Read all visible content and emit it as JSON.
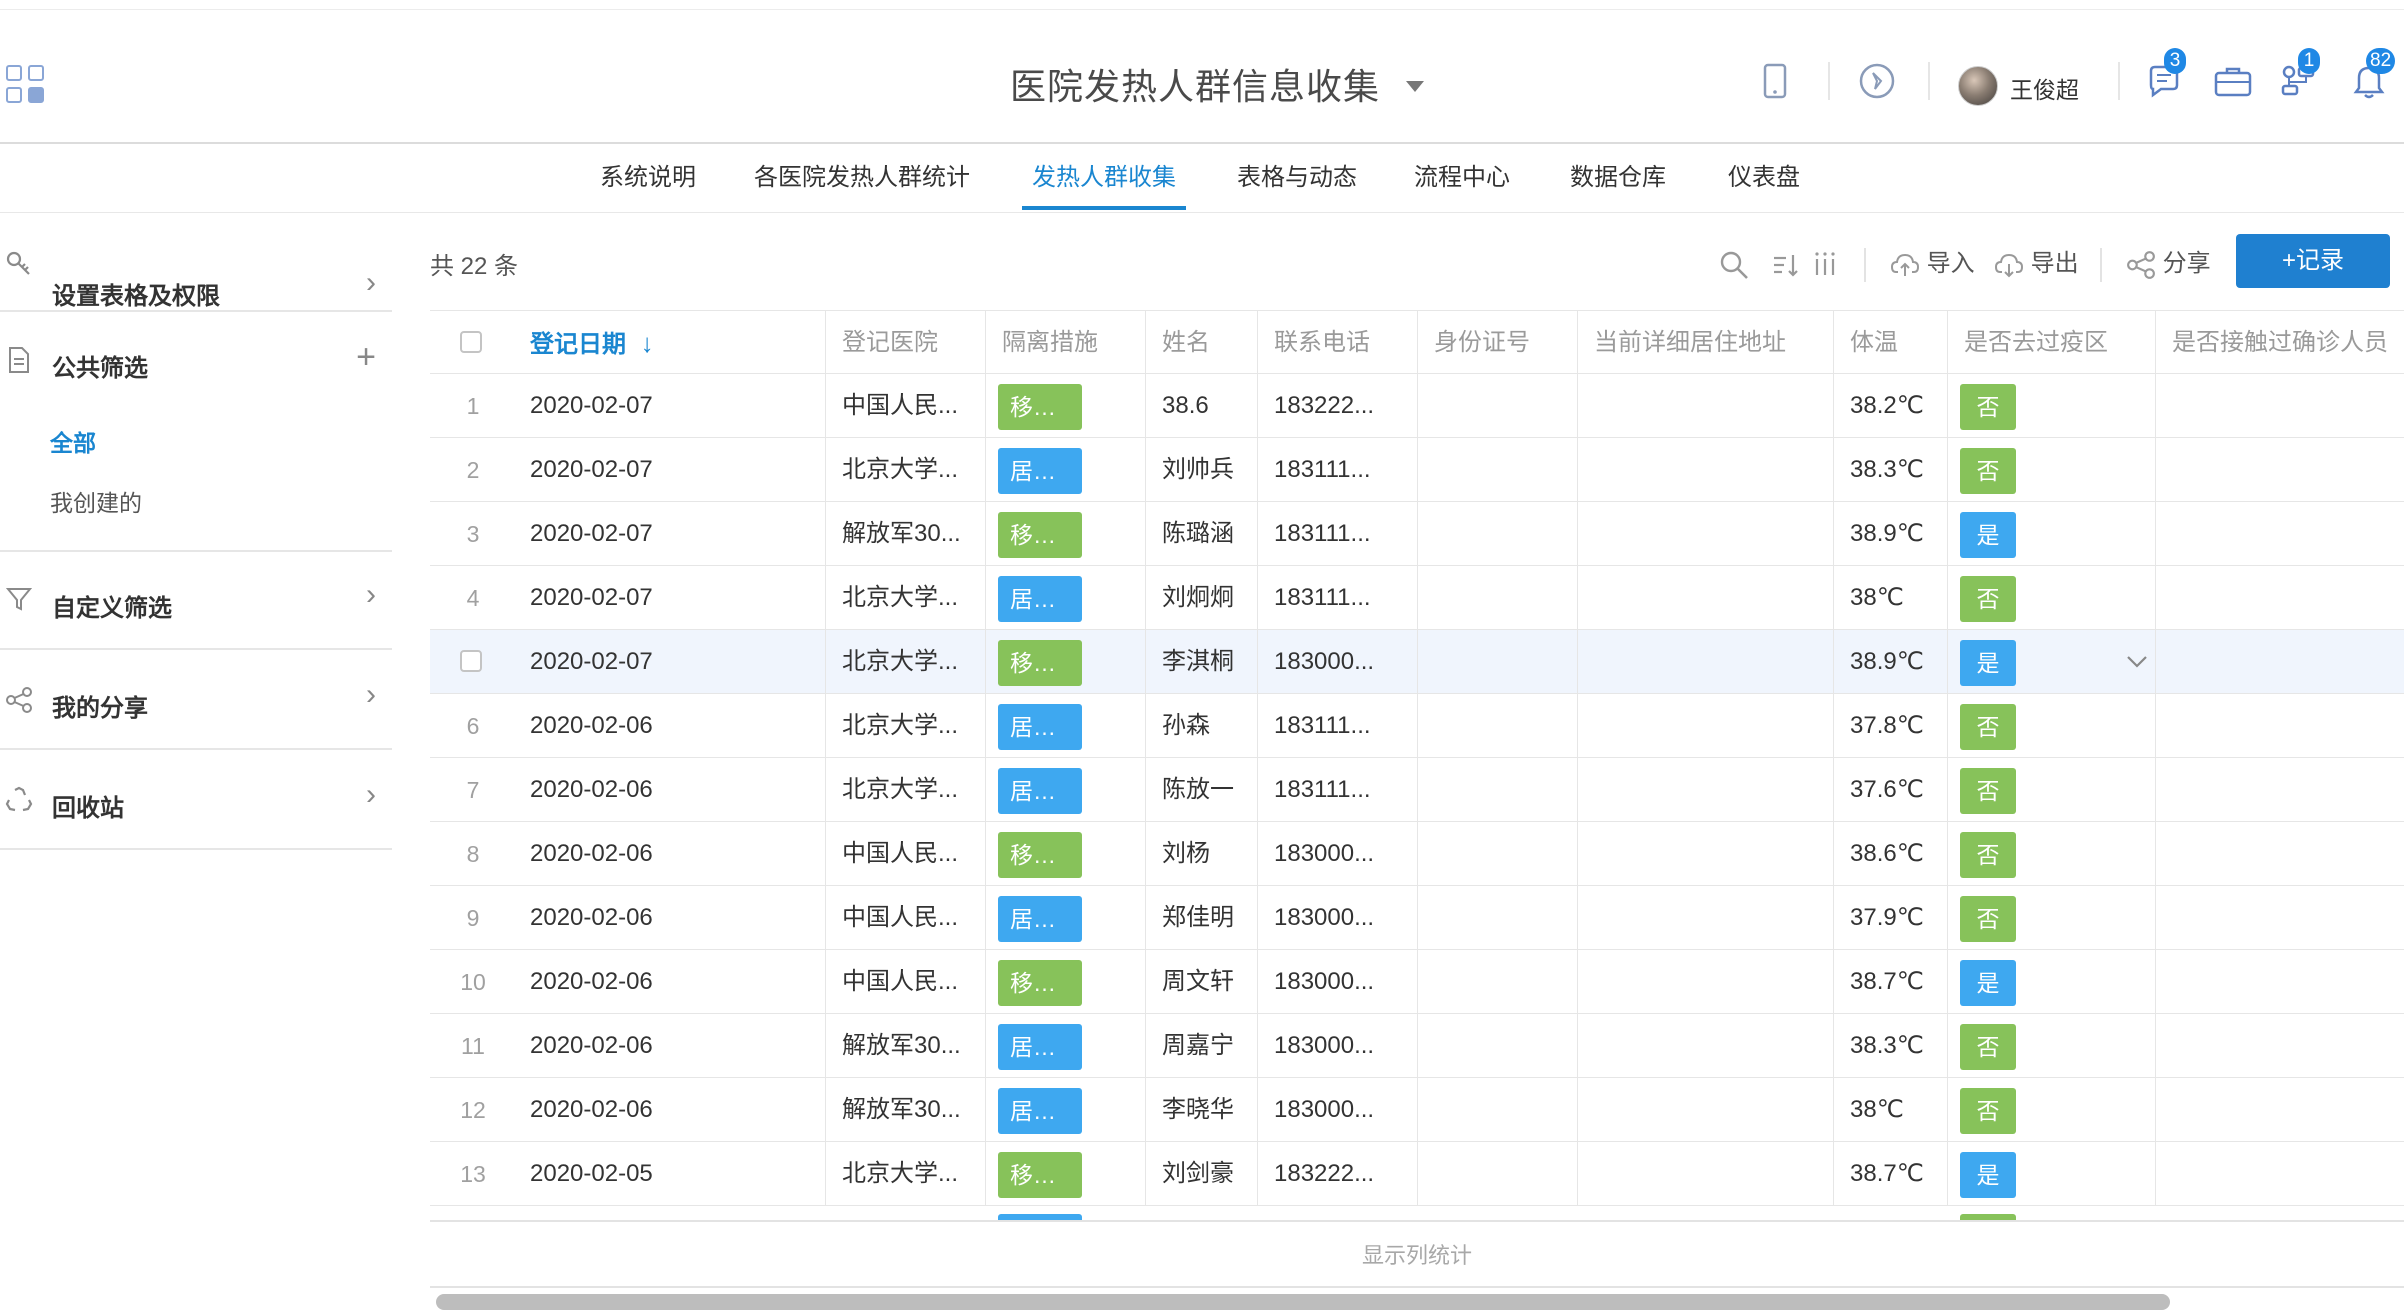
{
  "app": {
    "title": "医院发热人群信息收集",
    "username": "王俊超",
    "badges": {
      "messages": "3",
      "workflow": "1",
      "notifications": "82"
    }
  },
  "nav": {
    "tabs": [
      "系统说明",
      "各医院发热人群统计",
      "发热人群收集",
      "表格与动态",
      "流程中心",
      "数据仓库",
      "仪表盘"
    ],
    "active_tab": "发热人群收集"
  },
  "sidebar": {
    "settings_label": "设置表格及权限",
    "public_filter_label": "公共筛选",
    "filter_all": "全部",
    "filter_mine": "我创建的",
    "custom_filter_label": "自定义筛选",
    "my_share_label": "我的分享",
    "recycle_label": "回收站"
  },
  "toolbar": {
    "count_text": "共 22 条",
    "import_label": "导入",
    "export_label": "导出",
    "share_label": "分享",
    "add_record_label": "+记录"
  },
  "table": {
    "columns": [
      "登记日期",
      "登记医院",
      "隔离措施",
      "姓名",
      "联系电话",
      "身份证号",
      "当前详细居住地址",
      "体温",
      "是否去过疫区",
      "是否接触过确诊人员"
    ],
    "sorted_column": "登记日期",
    "rows": [
      {
        "num": "1",
        "date": "2020-02-07",
        "hospital": "中国人民...",
        "measure": "移送就...",
        "measure_color": "green",
        "name": "38.6",
        "phone": "183222...",
        "temp": "38.2℃",
        "epidemic": "否",
        "epidemic_color": "green"
      },
      {
        "num": "2",
        "date": "2020-02-07",
        "hospital": "北京大学...",
        "measure": "居家隔...",
        "measure_color": "blue",
        "name": "刘帅兵",
        "phone": "183111...",
        "temp": "38.3℃",
        "epidemic": "否",
        "epidemic_color": "green"
      },
      {
        "num": "3",
        "date": "2020-02-07",
        "hospital": "解放军30...",
        "measure": "移送就...",
        "measure_color": "green",
        "name": "陈璐涵",
        "phone": "183111...",
        "temp": "38.9℃",
        "epidemic": "是",
        "epidemic_color": "blue"
      },
      {
        "num": "4",
        "date": "2020-02-07",
        "hospital": "北京大学...",
        "measure": "居家隔...",
        "measure_color": "blue",
        "name": "刘炯炯",
        "phone": "183111...",
        "temp": "38℃",
        "epidemic": "否",
        "epidemic_color": "green"
      },
      {
        "num": "",
        "date": "2020-02-07",
        "hospital": "北京大学...",
        "measure": "移送就...",
        "measure_color": "green",
        "name": "李淇桐",
        "phone": "183000...",
        "temp": "38.9℃",
        "epidemic": "是",
        "epidemic_color": "blue"
      },
      {
        "num": "6",
        "date": "2020-02-06",
        "hospital": "北京大学...",
        "measure": "居家隔...",
        "measure_color": "blue",
        "name": "孙森",
        "phone": "183111...",
        "temp": "37.8℃",
        "epidemic": "否",
        "epidemic_color": "green"
      },
      {
        "num": "7",
        "date": "2020-02-06",
        "hospital": "北京大学...",
        "measure": "居家隔...",
        "measure_color": "blue",
        "name": "陈放一",
        "phone": "183111...",
        "temp": "37.6℃",
        "epidemic": "否",
        "epidemic_color": "green"
      },
      {
        "num": "8",
        "date": "2020-02-06",
        "hospital": "中国人民...",
        "measure": "移送就...",
        "measure_color": "green",
        "name": "刘杨",
        "phone": "183000...",
        "temp": "38.6℃",
        "epidemic": "否",
        "epidemic_color": "green"
      },
      {
        "num": "9",
        "date": "2020-02-06",
        "hospital": "中国人民...",
        "measure": "居家隔...",
        "measure_color": "blue",
        "name": "郑佳明",
        "phone": "183000...",
        "temp": "37.9℃",
        "epidemic": "否",
        "epidemic_color": "green"
      },
      {
        "num": "10",
        "date": "2020-02-06",
        "hospital": "中国人民...",
        "measure": "移送就...",
        "measure_color": "green",
        "name": "周文轩",
        "phone": "183000...",
        "temp": "38.7℃",
        "epidemic": "是",
        "epidemic_color": "blue"
      },
      {
        "num": "11",
        "date": "2020-02-06",
        "hospital": "解放军30...",
        "measure": "居家隔...",
        "measure_color": "blue",
        "name": "周嘉宁",
        "phone": "183000...",
        "temp": "38.3℃",
        "epidemic": "否",
        "epidemic_color": "green"
      },
      {
        "num": "12",
        "date": "2020-02-06",
        "hospital": "解放军30...",
        "measure": "居家隔...",
        "measure_color": "blue",
        "name": "李晓华",
        "phone": "183000...",
        "temp": "38℃",
        "epidemic": "否",
        "epidemic_color": "green"
      },
      {
        "num": "13",
        "date": "2020-02-05",
        "hospital": "北京大学...",
        "measure": "移送就...",
        "measure_color": "green",
        "name": "刘剑豪",
        "phone": "183222...",
        "temp": "38.7℃",
        "epidemic": "是",
        "epidemic_color": "blue"
      }
    ]
  },
  "footer": {
    "stats_label": "显示列统计"
  },
  "colors": {
    "accent": "#1a86d0",
    "green_tag": "#87c25a",
    "blue_tag": "#3ea8f0"
  }
}
